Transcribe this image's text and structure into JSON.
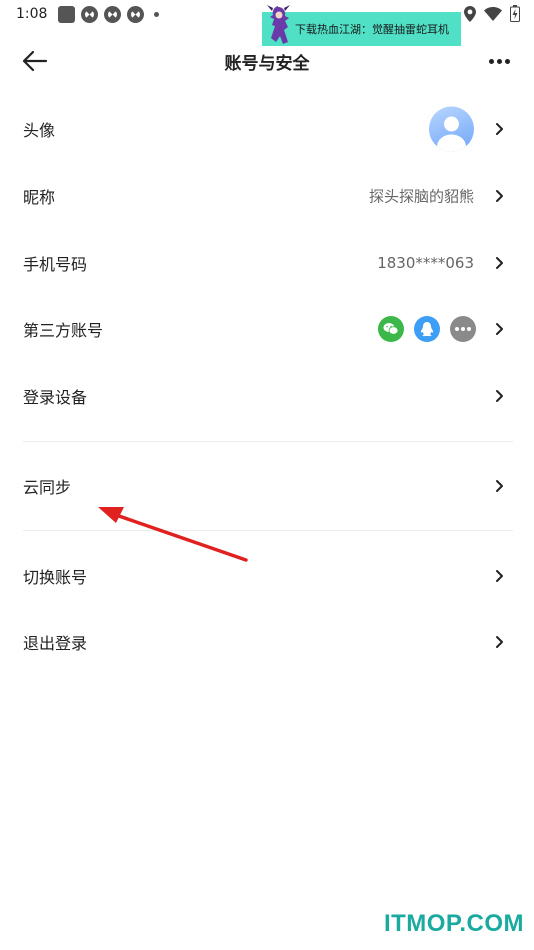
{
  "status_bar": {
    "time": "1:08"
  },
  "ad_banner": {
    "text": "下载热血江湖：觉醒抽雷蛇耳机"
  },
  "header": {
    "title": "账号与安全"
  },
  "rows": [
    {
      "label": "头像"
    },
    {
      "label": "昵称",
      "value": "探头探脑的貂熊"
    },
    {
      "label": "手机号码",
      "value": "1830****063"
    },
    {
      "label": "第三方账号",
      "accounts": [
        "wechat-icon",
        "qq-icon",
        "more-icon"
      ]
    },
    {
      "label": "登录设备"
    },
    {
      "label": "云同步"
    },
    {
      "label": "切换账号"
    },
    {
      "label": "退出登录"
    }
  ],
  "colors": {
    "wechat": "#3cb84a",
    "qq": "#3d9ef5",
    "arrow": "#e0211f",
    "watermark": "#1aaaa0"
  },
  "watermark": "ITMOP.COM"
}
